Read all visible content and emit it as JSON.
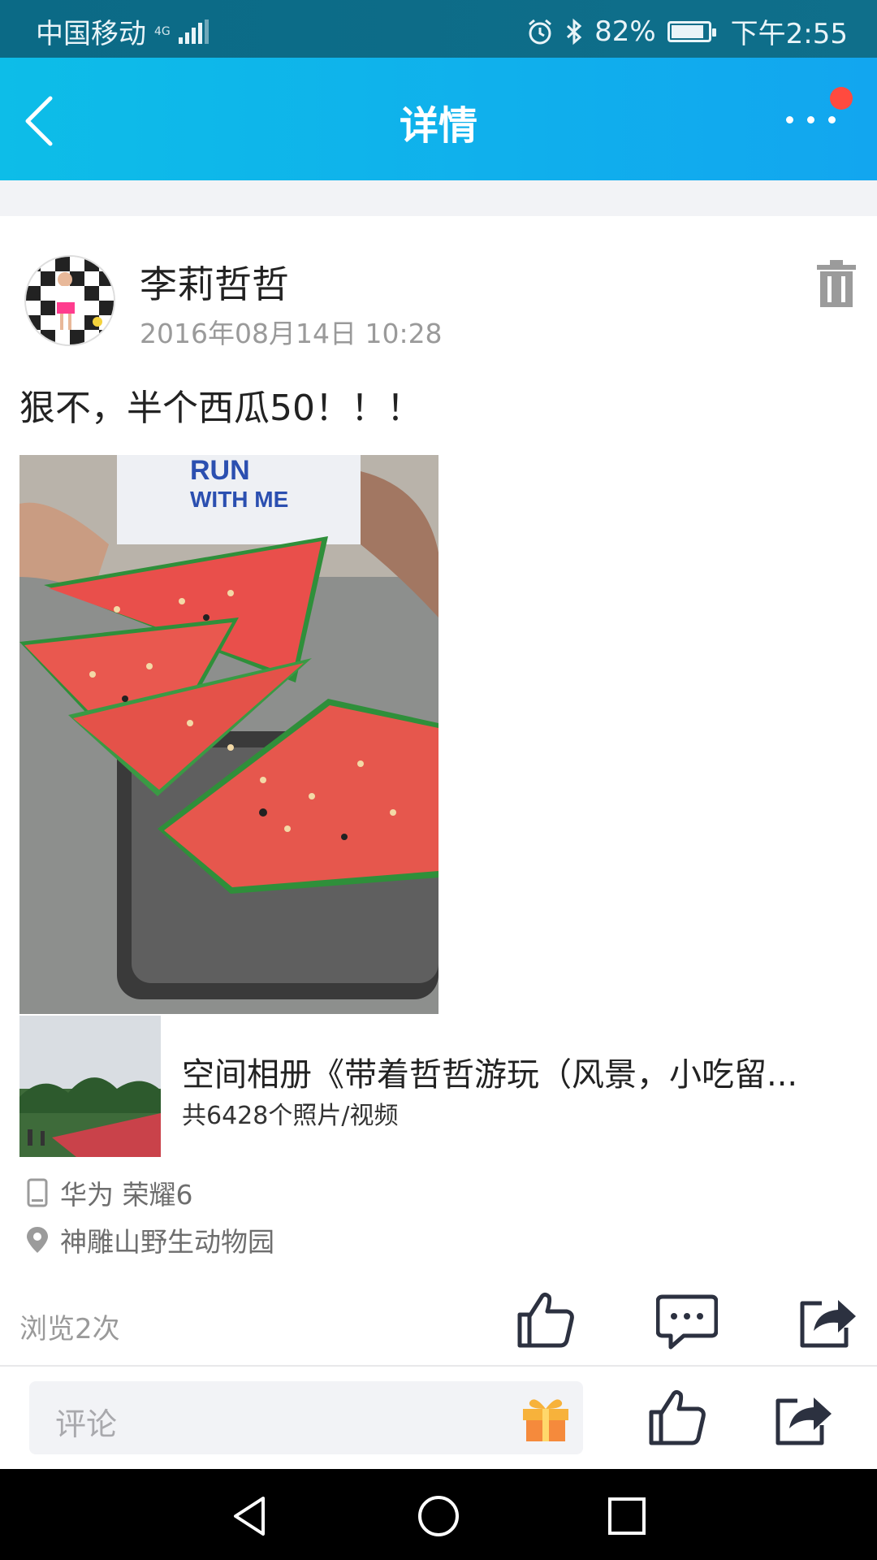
{
  "status_bar": {
    "carrier": "中国移动",
    "network": "4G",
    "battery_percent_text": "82%",
    "battery_level": 0.82,
    "time": "下午2:55"
  },
  "header": {
    "title": "详情",
    "back_icon": "chevron-left-icon",
    "more_icon": "more-horizontal-icon",
    "accent_color": "#12A6EF",
    "notify_color": "#FF4A3F"
  },
  "post": {
    "username": "李莉哲哲",
    "timestamp": "2016年08月14日 10:28",
    "text": "狠不，半个西瓜50！！！",
    "photo_icon": "watermelon-photo",
    "album": {
      "title": "空间相册《带着哲哲游玩（风景，小吃留...",
      "count": "共6428个照片/视频"
    },
    "device": "华为 荣耀6",
    "location": "神雕山野生动物园",
    "views": "浏览2次"
  },
  "comment_bar": {
    "placeholder": "评论",
    "gift_icon": "gift-icon"
  },
  "nav_bar": {
    "icons": [
      "back-triangle-icon",
      "home-circle-icon",
      "recents-square-icon"
    ]
  }
}
